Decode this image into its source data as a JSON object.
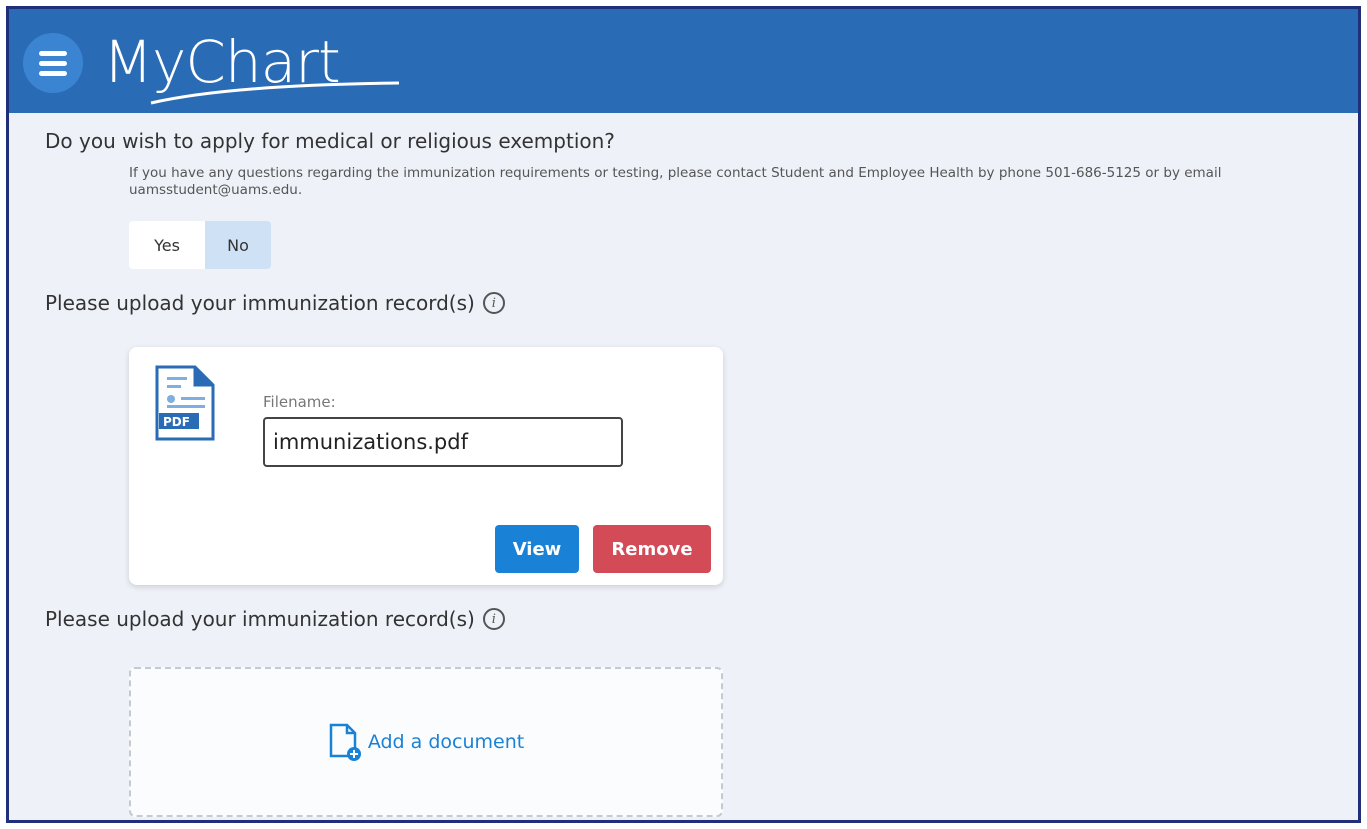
{
  "header": {
    "logo_text": "MyChart",
    "menu_icon": "hamburger-menu-icon"
  },
  "exemption": {
    "question": "Do you wish to apply for medical or religious exemption?",
    "help_text": "If you have any questions regarding the immunization requirements or testing, please contact Student and Employee Health by phone 501-686-5125 or by email uamsstudent@uams.edu.",
    "options": [
      "Yes",
      "No"
    ],
    "selected": "No"
  },
  "upload_1": {
    "label": "Please upload your immunization record(s)",
    "info_icon": "info-icon",
    "document": {
      "icon": "pdf-file-icon",
      "icon_text": "PDF",
      "filename_label": "Filename:",
      "filename_value": "immunizations.pdf",
      "view_label": "View",
      "remove_label": "Remove"
    }
  },
  "upload_2": {
    "label": "Please upload your immunization record(s)",
    "info_icon": "info-icon",
    "add_label": "Add a document"
  },
  "colors": {
    "header_bg": "#2a6bb6",
    "view_button": "#1a82d6",
    "remove_button": "#d24b57",
    "selected_toggle": "#cfe1f5",
    "link": "#1a82d6"
  }
}
